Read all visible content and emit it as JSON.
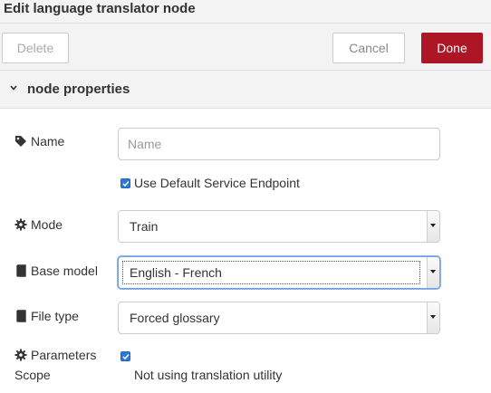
{
  "window": {
    "title": "Edit language translator node"
  },
  "buttons": {
    "delete": "Delete",
    "cancel": "Cancel",
    "done": "Done"
  },
  "section": {
    "label": "node properties"
  },
  "fields": {
    "name": {
      "label": "Name",
      "placeholder": "Name",
      "value": ""
    },
    "default_endpoint": {
      "label": "Use Default Service Endpoint",
      "checked": true
    },
    "mode": {
      "label": "Mode",
      "value": "Train"
    },
    "base_model": {
      "label": "Base model",
      "value": "English - French"
    },
    "file_type": {
      "label": "File type",
      "value": "Forced glossary"
    },
    "parameters_scope": {
      "label_line1": "Parameters",
      "label_line2": "Scope",
      "checked": true,
      "note": "Not using translation utility"
    }
  },
  "icons": {
    "name": "tag-icon",
    "mode": "gear-icon",
    "base_model": "book-icon",
    "file_type": "book-icon",
    "parameters": "gear-icon"
  },
  "colors": {
    "done_button": "#ad1625",
    "checkbox": "#2d7ad6",
    "focus_ring": "#6fa0e8"
  }
}
